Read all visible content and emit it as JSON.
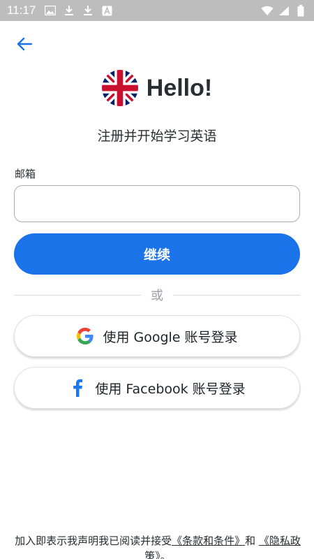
{
  "status_bar": {
    "time": "11:17",
    "left_icons": [
      "image-icon",
      "download-icon",
      "download-icon",
      "a-box-icon"
    ],
    "right_icons": [
      "wifi-icon",
      "signal-icon",
      "battery-icon"
    ]
  },
  "nav": {
    "back_icon": "arrow-left-icon"
  },
  "hero": {
    "title": "Hello!",
    "flag": "uk-flag-icon"
  },
  "subtitle": "注册并开始学习英语",
  "form": {
    "email_label": "邮箱",
    "email_value": "",
    "email_placeholder": "",
    "continue_label": "继续"
  },
  "divider_text": "或",
  "social": {
    "google_label": "使用 Google 账号登录",
    "facebook_label": "使用 Facebook 账号登录"
  },
  "legal": {
    "prefix": "加入即表示我声明我已阅读并接受",
    "terms": "《条款和条件》",
    "and": "和",
    "privacy": "《隐私政策》",
    "suffix": "。"
  },
  "colors": {
    "primary": "#1a73e8",
    "status_bar": "#bdbdbd",
    "text": "#2b2d33",
    "facebook": "#1877f2"
  }
}
